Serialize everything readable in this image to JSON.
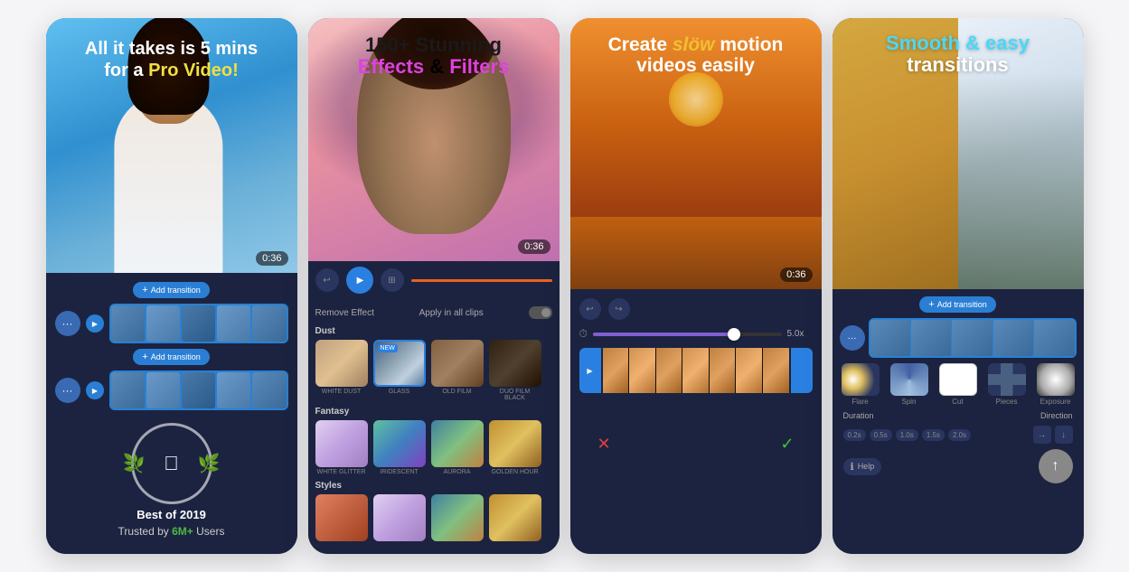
{
  "cards": [
    {
      "id": "card1",
      "heading_line1": "All it takes is 5 mins",
      "heading_line2_prefix": "for a ",
      "heading_highlight": "Pro Video!",
      "timer": "0:36",
      "add_transition_label": "Add transition",
      "award_year": "Best of 2019",
      "trusted_prefix": "Trusted by ",
      "trusted_highlight": "6M+",
      "trusted_suffix": " Users"
    },
    {
      "id": "card2",
      "heading_line1": "150+ Stunning",
      "heading_effects": "Effects",
      "heading_and": " & ",
      "heading_filters": "Filters",
      "timer": "0:36",
      "remove_effect_label": "Remove Effect",
      "apply_label": "Apply in all clips",
      "category1": "Dust",
      "category2": "Fantasy",
      "category3": "Styles",
      "effects_dust": [
        {
          "label": "WHITE DUST",
          "type": "dust"
        },
        {
          "label": "GLASS",
          "type": "glass",
          "new": true,
          "selected": true
        },
        {
          "label": "OLD FILM",
          "type": "film"
        },
        {
          "label": "DUO FILM BLACK",
          "type": "filmblk"
        }
      ],
      "effects_fantasy": [
        {
          "label": "WHITE GLITTER",
          "type": "glitter"
        },
        {
          "label": "IRIDESCENT",
          "type": "irides"
        },
        {
          "label": "AURORA",
          "type": "aurora"
        },
        {
          "label": "GOLDEN HOUR",
          "type": "golden"
        }
      ]
    },
    {
      "id": "card3",
      "heading_line1": "Create ",
      "heading_slow": "slöw",
      "heading_line1_rest": " motion",
      "heading_line2": "videos easily",
      "timer": "0:36",
      "speed_value": "5.0x",
      "confirm_cancel": "✕",
      "confirm_ok": "✓"
    },
    {
      "id": "card4",
      "heading_smooth": "Smooth",
      "heading_and": " & easy",
      "heading_line2": "transitions",
      "add_transition_label": "Add transition",
      "transitions": [
        {
          "label": "Flare",
          "type": "flare"
        },
        {
          "label": "Spin",
          "type": "spin"
        },
        {
          "label": "Cut",
          "type": "cut",
          "selected": true
        },
        {
          "label": "Pieces",
          "type": "pieces"
        },
        {
          "label": "Exposure",
          "type": "exposure"
        }
      ],
      "duration_label": "Duration",
      "direction_label": "Direction",
      "duration_pills": [
        "0.2s",
        "0.5s",
        "1.0s",
        "1.5s",
        "2.0s"
      ],
      "help_label": "Help",
      "arrow_right": "→",
      "arrow_down": "↓"
    }
  ]
}
